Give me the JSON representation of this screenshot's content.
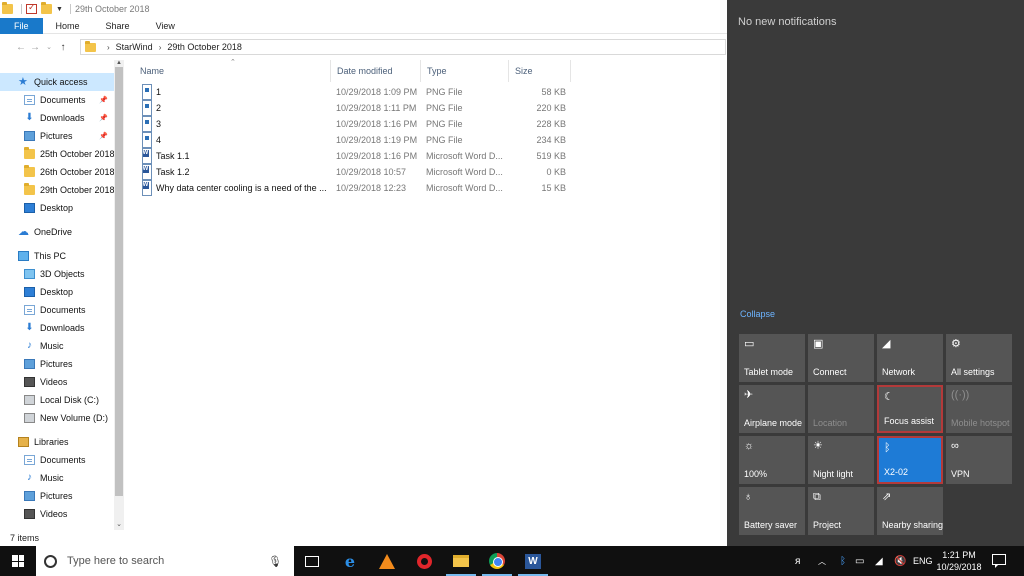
{
  "window": {
    "title": "29th October 2018",
    "ribbon_tabs": [
      "File",
      "Home",
      "Share",
      "View"
    ],
    "breadcrumb": [
      "StarWind",
      "29th October 2018"
    ]
  },
  "nav": {
    "items": [
      {
        "label": "Quick access",
        "icon": "star-icon",
        "selected": true,
        "pinned": false
      },
      {
        "label": "Documents",
        "icon": "documents-icon",
        "pinned": true
      },
      {
        "label": "Downloads",
        "icon": "downloads-icon",
        "pinned": true
      },
      {
        "label": "Pictures",
        "icon": "pictures-icon",
        "pinned": true
      },
      {
        "label": "25th October 2018",
        "icon": "folder-icon"
      },
      {
        "label": "26th October 2018",
        "icon": "folder-icon"
      },
      {
        "label": "29th October 2018",
        "icon": "folder-icon"
      },
      {
        "label": "Desktop",
        "icon": "desktop-icon"
      },
      {
        "label": "OneDrive",
        "icon": "onedrive-icon"
      },
      {
        "label": "This PC",
        "icon": "this-pc-icon"
      },
      {
        "label": "3D Objects",
        "icon": "3d-objects-icon"
      },
      {
        "label": "Desktop",
        "icon": "desktop-icon"
      },
      {
        "label": "Documents",
        "icon": "documents-icon"
      },
      {
        "label": "Downloads",
        "icon": "downloads-icon"
      },
      {
        "label": "Music",
        "icon": "music-icon"
      },
      {
        "label": "Pictures",
        "icon": "pictures-icon"
      },
      {
        "label": "Videos",
        "icon": "videos-icon"
      },
      {
        "label": "Local Disk (C:)",
        "icon": "disk-icon"
      },
      {
        "label": "New Volume (D:)",
        "icon": "disk-icon"
      },
      {
        "label": "Libraries",
        "icon": "libraries-icon"
      },
      {
        "label": "Documents",
        "icon": "documents-icon"
      },
      {
        "label": "Music",
        "icon": "music-icon"
      },
      {
        "label": "Pictures",
        "icon": "pictures-icon"
      },
      {
        "label": "Videos",
        "icon": "videos-icon"
      }
    ]
  },
  "files": {
    "columns": [
      "Name",
      "Date modified",
      "Type",
      "Size"
    ],
    "rows": [
      {
        "name": "1",
        "date": "10/29/2018 1:09 PM",
        "type": "PNG File",
        "size": "58 KB",
        "kind": "png"
      },
      {
        "name": "2",
        "date": "10/29/2018 1:11 PM",
        "type": "PNG File",
        "size": "220 KB",
        "kind": "png"
      },
      {
        "name": "3",
        "date": "10/29/2018 1:16 PM",
        "type": "PNG File",
        "size": "228 KB",
        "kind": "png"
      },
      {
        "name": "4",
        "date": "10/29/2018 1:19 PM",
        "type": "PNG File",
        "size": "234 KB",
        "kind": "png"
      },
      {
        "name": "Task 1.1",
        "date": "10/29/2018 1:16 PM",
        "type": "Microsoft Word D...",
        "size": "519 KB",
        "kind": "word"
      },
      {
        "name": "Task 1.2",
        "date": "10/29/2018 10:57",
        "type": "Microsoft Word D...",
        "size": "0 KB",
        "kind": "word"
      },
      {
        "name": "Why data center cooling is a need of the ...",
        "date": "10/29/2018 12:23",
        "type": "Microsoft Word D...",
        "size": "15 KB",
        "kind": "word"
      }
    ]
  },
  "status": {
    "item_count": "7 items"
  },
  "action_center": {
    "title": "No new notifications",
    "collapse_label": "Collapse",
    "tiles": [
      {
        "label": "Tablet mode",
        "icon": "tablet-mode-icon",
        "glyph": "▭",
        "state": "normal"
      },
      {
        "label": "Connect",
        "icon": "connect-icon",
        "glyph": "▣",
        "state": "normal"
      },
      {
        "label": "Network",
        "icon": "network-icon",
        "glyph": "◢",
        "state": "normal"
      },
      {
        "label": "All settings",
        "icon": "gear-icon",
        "glyph": "⚙",
        "state": "normal"
      },
      {
        "label": "Airplane mode",
        "icon": "airplane-icon",
        "glyph": "✈",
        "state": "normal"
      },
      {
        "label": "Location",
        "icon": "location-icon",
        "glyph": "",
        "state": "dim"
      },
      {
        "label": "Focus assist",
        "icon": "moon-icon",
        "glyph": "☾",
        "state": "focused"
      },
      {
        "label": "Mobile hotspot",
        "icon": "hotspot-icon",
        "glyph": "((·))",
        "state": "dim"
      },
      {
        "label": "100%",
        "icon": "brightness-icon",
        "glyph": "☼",
        "state": "normal"
      },
      {
        "label": "Night light",
        "icon": "night-light-icon",
        "glyph": "☀",
        "state": "normal"
      },
      {
        "label": "X2-02",
        "icon": "bluetooth-icon",
        "glyph": "ᛒ",
        "state": "active"
      },
      {
        "label": "VPN",
        "icon": "vpn-icon",
        "glyph": "∞",
        "state": "normal"
      },
      {
        "label": "Battery saver",
        "icon": "battery-saver-icon",
        "glyph": "♁",
        "state": "normal"
      },
      {
        "label": "Project",
        "icon": "project-icon",
        "glyph": "⧉",
        "state": "normal"
      },
      {
        "label": "Nearby sharing",
        "icon": "nearby-sharing-icon",
        "glyph": "⇗",
        "state": "normal"
      }
    ]
  },
  "taskbar": {
    "search_placeholder": "Type here to search",
    "language": "ENG",
    "time": "1:21 PM",
    "date": "10/29/2018"
  }
}
